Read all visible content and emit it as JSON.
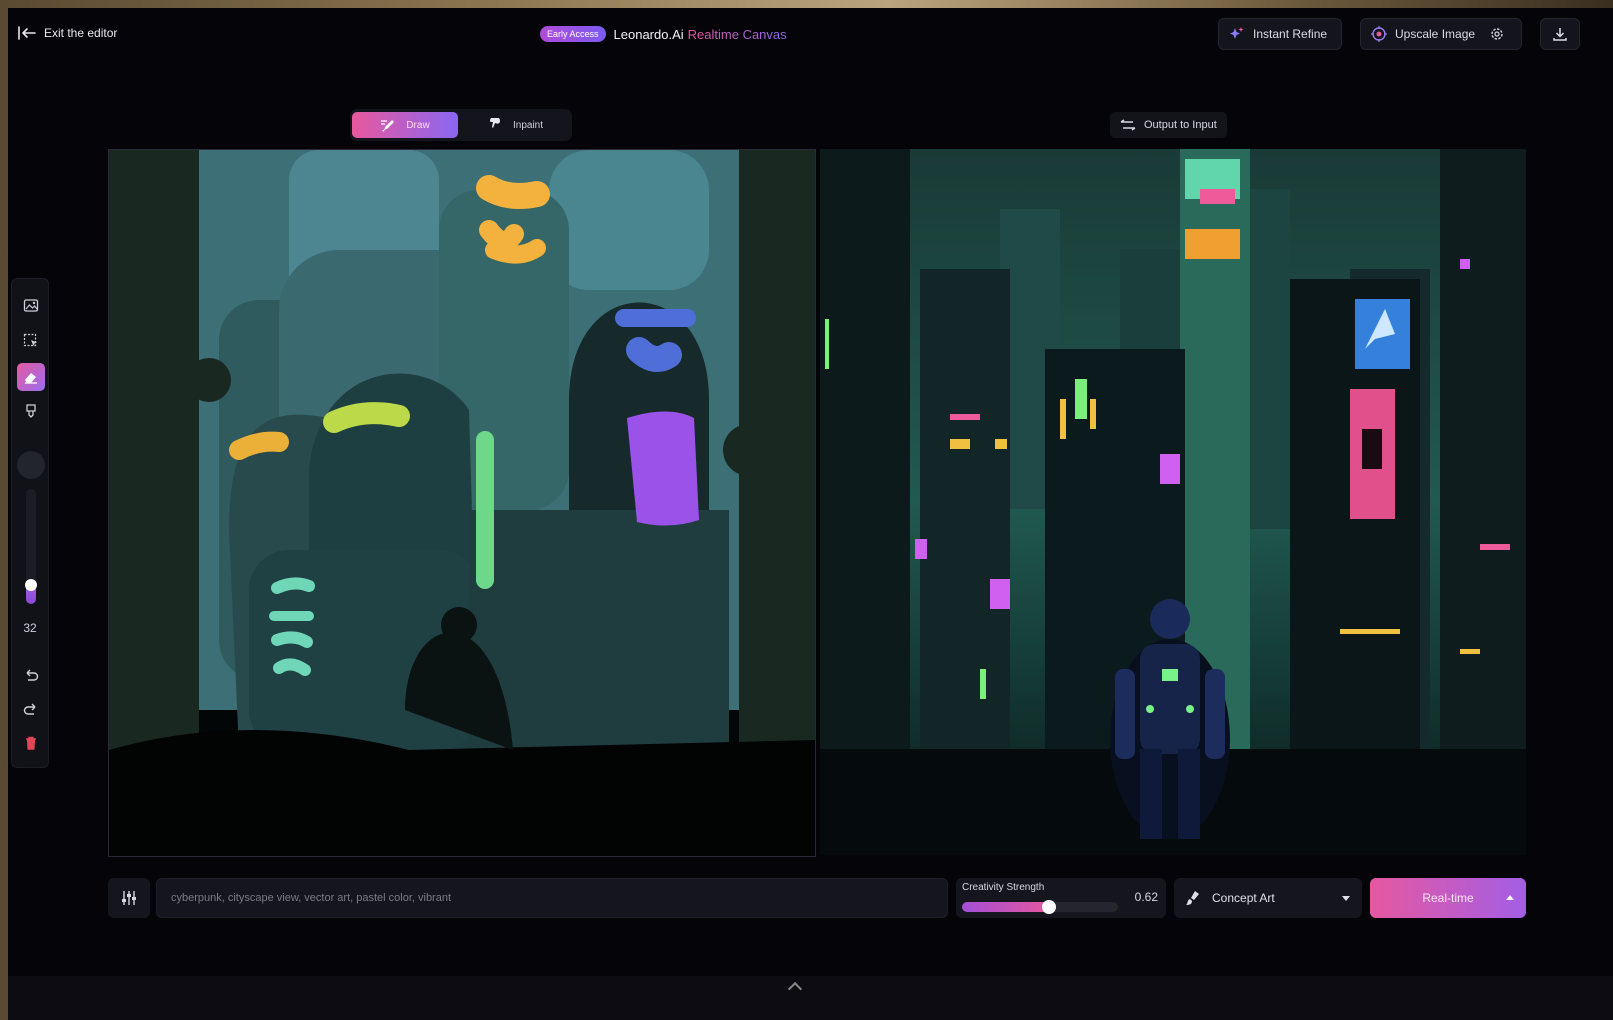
{
  "header": {
    "exit_label": "Exit the editor",
    "badge": "Early Access",
    "brand": "Leonardo.Ai",
    "brand_accent": "Realtime Canvas",
    "instant_refine": "Instant Refine",
    "upscale_image": "Upscale Image"
  },
  "modes": {
    "draw": "Draw",
    "inpaint": "Inpaint",
    "active": "draw"
  },
  "output_to_input": "Output to Input",
  "toolbar": {
    "tools": [
      "image-upload-icon",
      "select-icon",
      "eraser-brush-icon",
      "fill-icon"
    ],
    "brush_size": "32",
    "brush_size_level": 0.1
  },
  "prompt": {
    "value": "cyberpunk, cityscape view, vector art, pastel color, vibrant"
  },
  "creativity": {
    "label": "Creativity Strength",
    "value": "0.62",
    "fraction": 0.62
  },
  "style": {
    "selected": "Concept Art"
  },
  "realtime_label": "Real-time",
  "colors": {
    "accent_pink": "#e9589d",
    "accent_purple": "#8a66f2",
    "background": "#050509"
  }
}
